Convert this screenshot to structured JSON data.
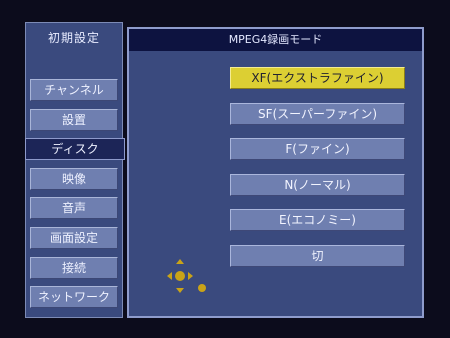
{
  "sidebar": {
    "title": "初期設定",
    "items": [
      {
        "label": "チャンネル",
        "active": false
      },
      {
        "label": "設置",
        "active": false
      },
      {
        "label": "ディスク",
        "active": true
      },
      {
        "label": "映像",
        "active": false
      },
      {
        "label": "音声",
        "active": false
      },
      {
        "label": "画面設定",
        "active": false
      },
      {
        "label": "接続",
        "active": false
      },
      {
        "label": "ネットワーク",
        "active": false
      }
    ]
  },
  "panel": {
    "title": "MPEG4録画モード",
    "options": [
      {
        "label": "XF(エクストラファイン)",
        "selected": true
      },
      {
        "label": "SF(スーパーファイン)",
        "selected": false
      },
      {
        "label": "F(ファイン)",
        "selected": false
      },
      {
        "label": "N(ノーマル)",
        "selected": false
      },
      {
        "label": "E(エコノミー)",
        "selected": false
      },
      {
        "label": "切",
        "selected": false
      }
    ]
  },
  "icons": {
    "dpad": "dpad-navigation-icon"
  },
  "colors": {
    "panel_bg": "#3a4a7e",
    "button": "#6f7fb0",
    "selected": "#dccf33",
    "header": "#0d1340",
    "active_sidebar": "#1c2557",
    "dpad": "#c9a318"
  }
}
